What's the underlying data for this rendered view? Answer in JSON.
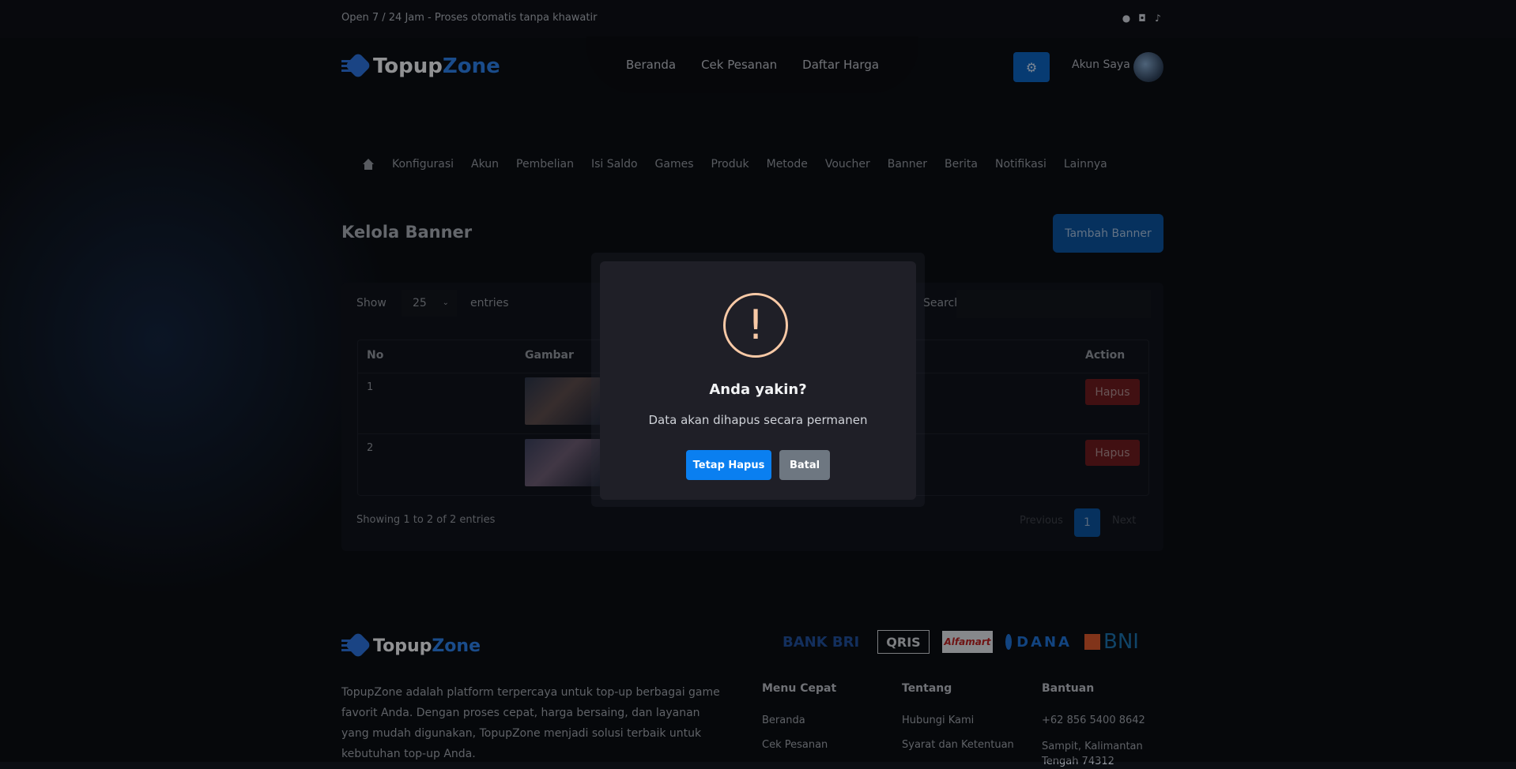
{
  "topbar": {
    "text": "Open 7 / 24 Jam - Proses otomatis tanpa khawatir"
  },
  "brand": {
    "part1": "Topup",
    "part2": "Zone"
  },
  "nav": {
    "items": [
      "Beranda",
      "Cek Pesanan",
      "Daftar Harga"
    ]
  },
  "account": {
    "label": "Akun Saya"
  },
  "admin_menu": {
    "items": [
      "Konfigurasi",
      "Akun",
      "Pembelian",
      "Isi Saldo",
      "Games",
      "Produk",
      "Metode",
      "Voucher",
      "Banner",
      "Berita",
      "Notifikasi",
      "Lainnya"
    ]
  },
  "page": {
    "title": "Kelola Banner",
    "add_button": "Tambah Banner"
  },
  "table_controls": {
    "show": "Show",
    "entries_value": "25",
    "entries": "entries",
    "search": "Search:"
  },
  "table": {
    "headers": [
      "No",
      "Gambar",
      "Action"
    ],
    "rows": [
      {
        "no": "1",
        "action": "Hapus"
      },
      {
        "no": "2",
        "action": "Hapus"
      }
    ]
  },
  "pagination": {
    "info": "Showing 1 to 2 of 2 entries",
    "previous": "Previous",
    "current": "1",
    "next": "Next"
  },
  "footer": {
    "description": "TopupZone adalah platform terpercaya untuk top-up berbagai game favorit Anda. Dengan proses cepat, harga bersaing, dan layanan yang mudah digunakan, TopupZone menjadi solusi terbaik untuk kebutuhan top-up Anda.",
    "banks": [
      "BANK BRI",
      "QRIS",
      "Alfamart",
      "DANA",
      "BNI"
    ],
    "menu_title": "Menu Cepat",
    "menu_items": [
      "Beranda",
      "Cek Pesanan"
    ],
    "about_title": "Tentang",
    "about_items": [
      "Hubungi Kami",
      "Syarat dan Ketentuan"
    ],
    "help_title": "Bantuan",
    "help_items": [
      "+62 856 5400 8642",
      "Sampit, Kalimantan Tengah 74312"
    ]
  },
  "modal": {
    "icon": "!",
    "title": "Anda yakin?",
    "text": "Data akan dihapus secara permanen",
    "confirm": "Tetap Hapus",
    "cancel": "Batal"
  },
  "colors": {
    "accent": "#0a7ff0",
    "danger": "#6a1b1e",
    "warning": "#f8c9a6",
    "cancel": "#6e7781"
  },
  "icons": [
    "whatsapp-icon",
    "instagram-icon",
    "tiktok-icon",
    "gear-icon",
    "home-icon",
    "chevron-down-icon",
    "warning-icon"
  ]
}
